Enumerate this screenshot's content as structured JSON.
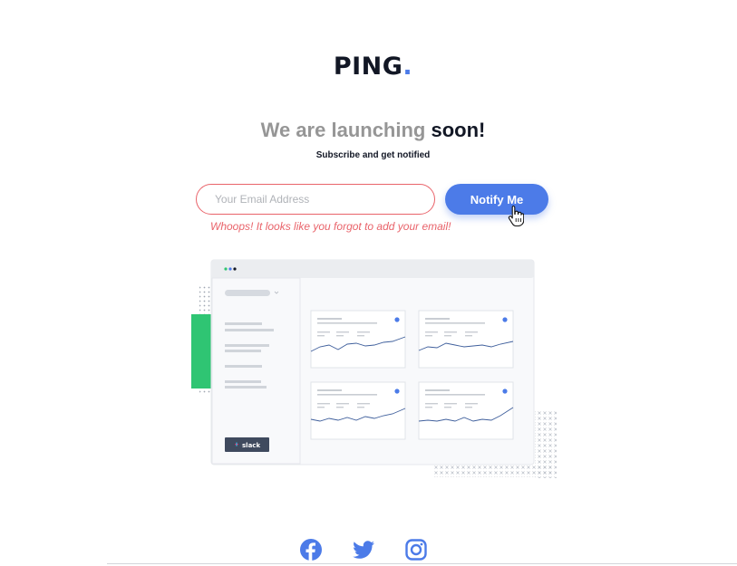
{
  "brand": {
    "name": "PING",
    "dot": ".",
    "accent_color": "#4c7be8"
  },
  "hero": {
    "headline_lead": "We are launching",
    "headline_emphasis": "soon!",
    "subtitle": "Subscribe and get notified"
  },
  "form": {
    "email_placeholder": "Your Email Address",
    "email_value": "",
    "submit_label": "Notify Me",
    "error_message": "Whoops! It looks like you forgot to add your email!",
    "error_color": "#e9636a"
  },
  "illustration": {
    "sidebar_badge": "slack",
    "card_count": 4
  },
  "socials": [
    {
      "name": "facebook",
      "icon": "facebook-icon"
    },
    {
      "name": "twitter",
      "icon": "twitter-icon"
    },
    {
      "name": "instagram",
      "icon": "instagram-icon"
    }
  ]
}
